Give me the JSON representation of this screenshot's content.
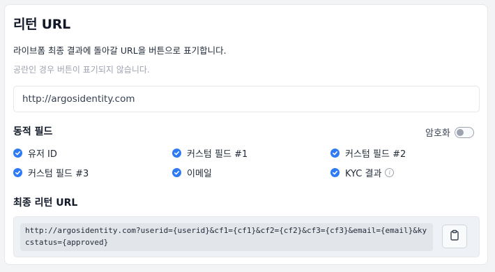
{
  "header": {
    "title": "리턴 URL"
  },
  "description": "라이브폼 최종 결과에 돌아갈 URL을 버튼으로 표기합니다.",
  "hint": "공란인 경우 버튼이 표기되지 않습니다.",
  "url_input": {
    "value": "http://argosidentity.com"
  },
  "dynamic_fields": {
    "title": "동적 필드",
    "encryption_label": "암호화",
    "encryption_enabled": false,
    "fields": [
      {
        "label": "유저 ID",
        "checked": true
      },
      {
        "label": "커스텀 필드 #1",
        "checked": true
      },
      {
        "label": "커스텀 필드 #2",
        "checked": true
      },
      {
        "label": "커스텀 필드 #3",
        "checked": true
      },
      {
        "label": "이메일",
        "checked": true
      },
      {
        "label": "KYC 결과",
        "checked": true
      }
    ]
  },
  "final_url": {
    "title": "최종 리턴 URL",
    "value": "http://argosidentity.com?userid={userid}&cf1={cf1}&cf2={cf2}&cf3={cf3}&email={email}&kycstatus={approved}"
  },
  "colors": {
    "accent": "#2f7bf5"
  }
}
